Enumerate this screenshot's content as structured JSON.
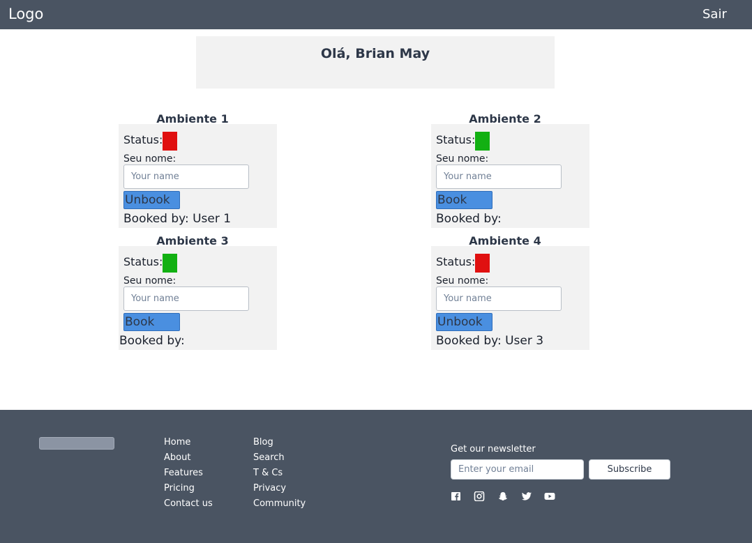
{
  "header": {
    "logo": "Logo",
    "logout": "Sair"
  },
  "greeting": "Olá, Brian May",
  "rooms": [
    {
      "title": "Ambiente 1",
      "status_label": "Status:",
      "status_color": "#e01010",
      "name_label": "Seu nome:",
      "name_placeholder": "Your name",
      "action": "Unbook",
      "booked_by": "Booked by: User 1"
    },
    {
      "title": "Ambiente 2",
      "status_label": "Status:",
      "status_color": "#12b012",
      "name_label": "Seu nome:",
      "name_placeholder": "Your name",
      "action": "Book",
      "booked_by": "Booked by:"
    },
    {
      "title": "Ambiente 3",
      "status_label": "Status:",
      "status_color": "#12b012",
      "name_label": "Seu nome:",
      "name_placeholder": "Your name",
      "action": "Book",
      "booked_by": "Booked by:"
    },
    {
      "title": "Ambiente 4",
      "status_label": "Status:",
      "status_color": "#e01010",
      "name_label": "Seu nome:",
      "name_placeholder": "Your name",
      "action": "Unbook",
      "booked_by": "Booked by: User 3"
    }
  ],
  "footer": {
    "links_col1": [
      "Home",
      "About",
      "Features",
      "Pricing",
      "Contact us"
    ],
    "links_col2": [
      "Blog",
      "Search",
      "T & Cs",
      "Privacy",
      "Community"
    ],
    "newsletter_label": "Get our newsletter",
    "email_placeholder": "Enter your email",
    "subscribe": "Subscribe",
    "social_icons": [
      "facebook-icon",
      "instagram-icon",
      "snapchat-icon",
      "twitter-icon",
      "youtube-icon"
    ]
  }
}
